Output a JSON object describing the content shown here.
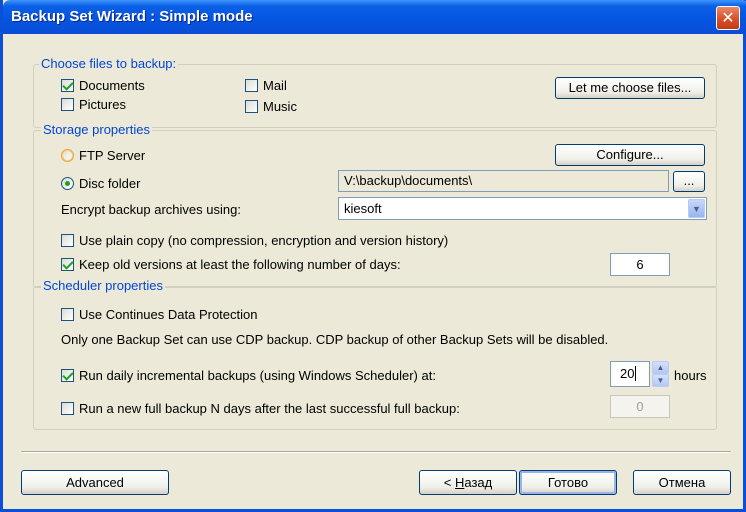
{
  "window": {
    "title": "Backup Set Wizard : Simple mode",
    "close_glyph": "✕"
  },
  "files": {
    "legend": "Choose files to backup:",
    "documents": {
      "label": "Documents",
      "checked": true
    },
    "pictures": {
      "label": "Pictures",
      "checked": false
    },
    "mail": {
      "label": "Mail",
      "checked": false
    },
    "music": {
      "label": "Music",
      "checked": false
    },
    "choose_button": "Let me choose files..."
  },
  "storage": {
    "legend": "Storage properties",
    "ftp": {
      "label": "FTP Server",
      "selected": false
    },
    "configure_button": "Configure...",
    "disc": {
      "label": "Disc folder",
      "selected": true
    },
    "disc_path": "V:\\backup\\documents\\",
    "browse_button": "...",
    "encrypt_label": "Encrypt backup archives using:",
    "encrypt_value": "kiesoft",
    "plain_copy": {
      "label": "Use plain copy (no compression, encryption and version history)",
      "checked": false
    },
    "keep_versions": {
      "label": "Keep old versions at least the following number of days:",
      "checked": true
    },
    "keep_days": "6"
  },
  "scheduler": {
    "legend": "Scheduler properties",
    "cdp": {
      "label": "Use Continues Data Protection",
      "checked": false
    },
    "cdp_note": "Only one Backup Set can use CDP backup. CDP backup of other Backup Sets will be disabled.",
    "daily": {
      "label": "Run daily incremental backups (using Windows Scheduler) at:",
      "checked": true
    },
    "daily_hours": "20",
    "hours_label": "hours",
    "full": {
      "label": "Run a new full backup N days after the last successful full backup:",
      "checked": false
    },
    "full_days": "0"
  },
  "footer": {
    "advanced": "Advanced",
    "back_prefix": "< ",
    "back_mnemonic": "Н",
    "back_rest": "азад",
    "finish": "Готово",
    "cancel": "Отмена"
  },
  "colors": {
    "titlebar": "#0554e1",
    "legend_text": "#0046d5",
    "check_mark": "#21a121",
    "window_bg": "#ece9d8"
  }
}
